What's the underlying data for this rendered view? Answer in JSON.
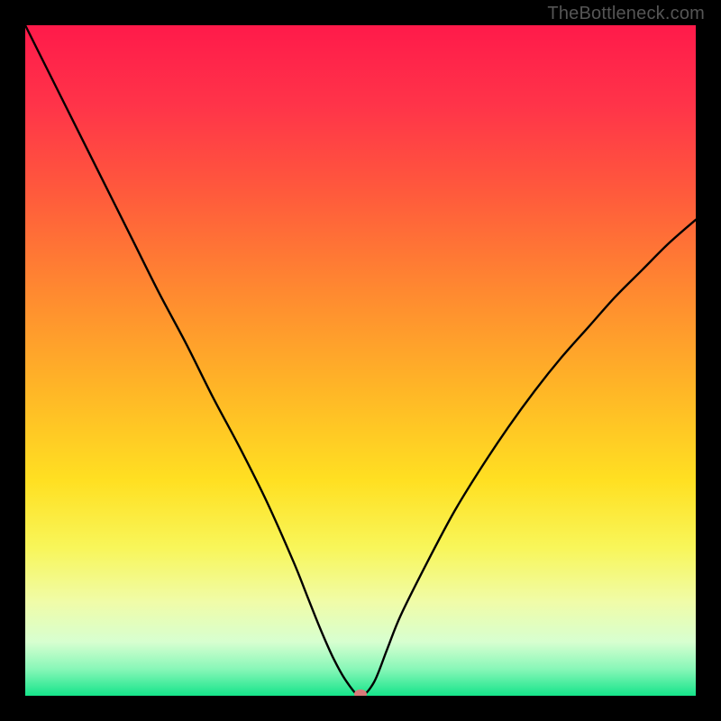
{
  "watermark": "TheBottleneck.com",
  "chart_data": {
    "type": "line",
    "title": "",
    "xlabel": "",
    "ylabel": "",
    "xlim": [
      0,
      100
    ],
    "ylim": [
      0,
      100
    ],
    "grid": false,
    "legend": false,
    "background_gradient": {
      "type": "vertical",
      "stops": [
        {
          "offset": 0.0,
          "color": "#ff1a4a"
        },
        {
          "offset": 0.12,
          "color": "#ff3449"
        },
        {
          "offset": 0.25,
          "color": "#ff5a3c"
        },
        {
          "offset": 0.4,
          "color": "#ff8a30"
        },
        {
          "offset": 0.55,
          "color": "#ffb826"
        },
        {
          "offset": 0.68,
          "color": "#ffe022"
        },
        {
          "offset": 0.78,
          "color": "#f8f65a"
        },
        {
          "offset": 0.86,
          "color": "#f0fca8"
        },
        {
          "offset": 0.92,
          "color": "#d7ffd0"
        },
        {
          "offset": 0.96,
          "color": "#88f7b8"
        },
        {
          "offset": 1.0,
          "color": "#15e48a"
        }
      ]
    },
    "series": [
      {
        "name": "bottleneck-curve",
        "stroke": "#000000",
        "stroke_width": 2.4,
        "x": [
          0.0,
          4.0,
          8.0,
          12.0,
          16.0,
          20.0,
          24.0,
          28.0,
          32.0,
          36.0,
          40.0,
          42.0,
          44.0,
          46.0,
          48.0,
          50.0,
          52.0,
          54.0,
          56.0,
          60.0,
          64.0,
          68.0,
          72.0,
          76.0,
          80.0,
          84.0,
          88.0,
          92.0,
          96.0,
          100.0
        ],
        "y": [
          100.0,
          92.0,
          84.0,
          76.0,
          68.0,
          60.0,
          52.5,
          44.5,
          37.0,
          29.0,
          20.0,
          15.0,
          10.0,
          5.5,
          2.0,
          0.0,
          2.0,
          7.0,
          12.0,
          20.0,
          27.5,
          34.0,
          40.0,
          45.5,
          50.5,
          55.0,
          59.5,
          63.5,
          67.5,
          71.0
        ]
      }
    ],
    "marker": {
      "name": "optimum-marker",
      "x": 50.0,
      "y": 0.0,
      "color": "#d97a7a",
      "rx": 7,
      "ry": 5
    }
  }
}
